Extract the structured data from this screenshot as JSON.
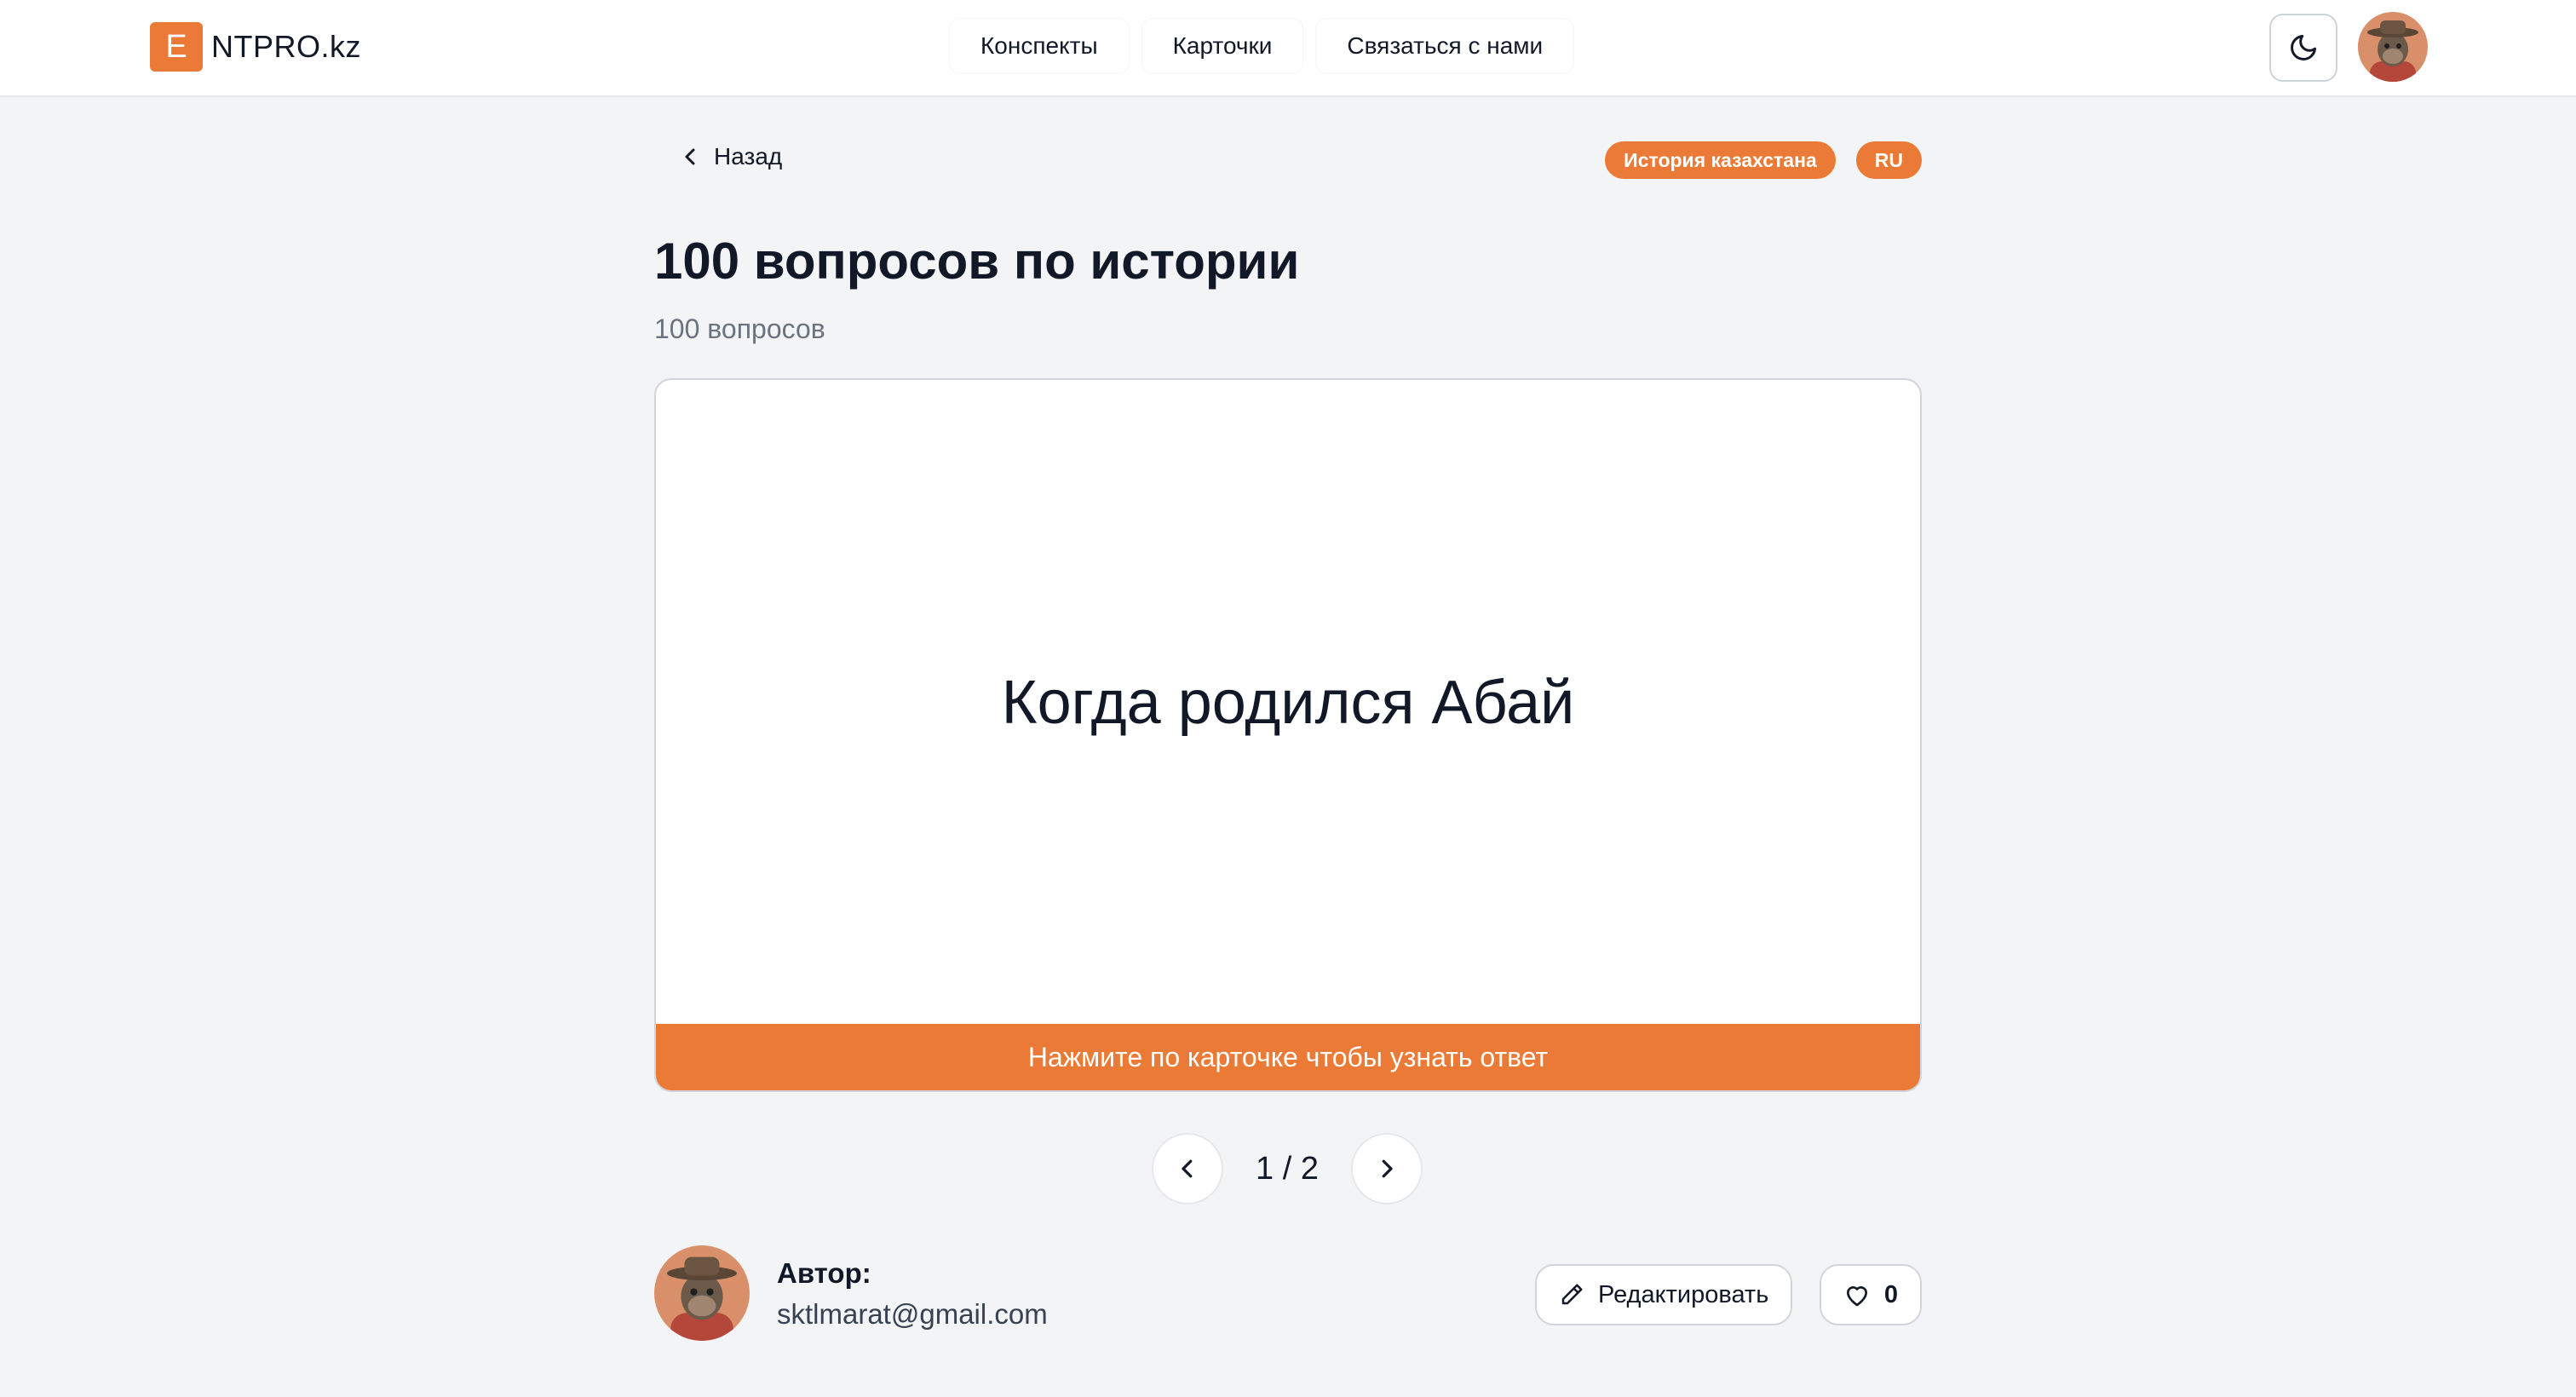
{
  "header": {
    "logo_letter": "E",
    "logo_text": "NTPRO.kz",
    "nav": [
      {
        "label": "Конспекты"
      },
      {
        "label": "Карточки"
      },
      {
        "label": "Связаться с нами"
      }
    ],
    "theme_icon": "moon-icon",
    "avatar_icon": "user-avatar"
  },
  "page": {
    "back_label": "Назад",
    "tags": [
      "История казахстана",
      "RU"
    ],
    "title": "100 вопросов по истории",
    "subtitle": "100 вопросов"
  },
  "card": {
    "question": "Когда родился Абай",
    "hint": "Нажмите по карточке чтобы узнать ответ"
  },
  "pager": {
    "count_text": "1 / 2",
    "prev_icon": "chevron-left-icon",
    "next_icon": "chevron-right-icon"
  },
  "author": {
    "label": "Автор:",
    "email": "sktlmarat@gmail.com"
  },
  "actions": {
    "edit_label": "Редактировать",
    "likes": "0"
  },
  "colors": {
    "accent": "#ea7a35",
    "background": "#f3f4f6",
    "card": "#ffffff"
  }
}
